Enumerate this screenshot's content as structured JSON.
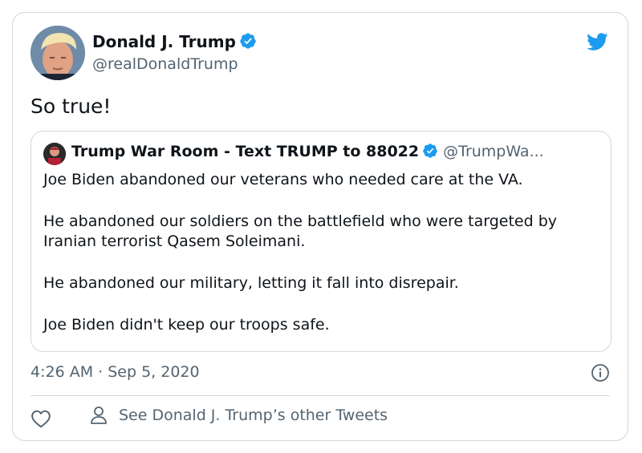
{
  "tweet": {
    "author": {
      "name": "Donald J. Trump",
      "handle": "@realDonaldTrump",
      "verified": true
    },
    "text": "So true!",
    "timestamp": "4:26 AM · Sep 5, 2020",
    "quoted": {
      "name": "Trump War Room - Text TRUMP to 88022",
      "handle": "@TrumpWa...",
      "verified": true,
      "paragraphs": [
        "Joe Biden abandoned our veterans who needed care at the VA.",
        "He abandoned our soldiers on the battlefield who were targeted by Iranian terrorist Qasem Soleimani.",
        "He abandoned our military, letting it fall into disrepair.",
        "Joe Biden didn't keep our troops safe."
      ]
    },
    "actions": {
      "see_more_label": "See Donald J. Trump’s other Tweets"
    }
  },
  "icons": {
    "brand": "twitter-bird-icon",
    "verified": "verified-badge-icon",
    "info": "info-icon",
    "like": "heart-icon",
    "person": "person-icon"
  },
  "colors": {
    "twitter_blue": "#1d9bf0",
    "text_primary": "#0f1419",
    "text_secondary": "#536471",
    "border": "#cfd9de"
  }
}
